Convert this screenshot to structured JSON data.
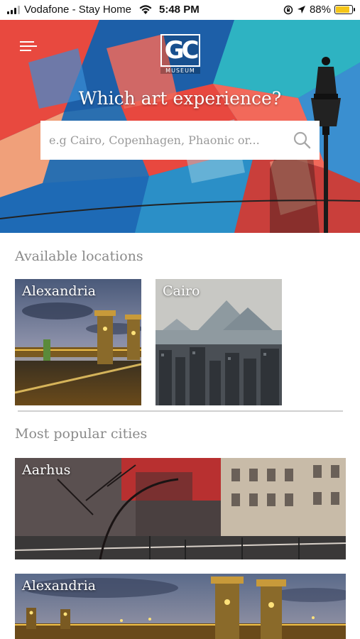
{
  "status_bar": {
    "carrier": "Vodafone - Stay Home",
    "time": "5:48 PM",
    "battery_percent": "88%",
    "battery_level": 0.88,
    "battery_color": "#f5c518",
    "icons": [
      "signal-icon",
      "wifi-icon",
      "orientation-lock-icon",
      "location-arrow-icon",
      "battery-icon"
    ]
  },
  "header": {
    "logo_letters": "GC",
    "logo_subtitle": "MUSEUM",
    "title": "Which art experience?",
    "menu_icon": "hamburger-menu-icon"
  },
  "search": {
    "placeholder": "e.g Cairo, Copenhagen, Phaonic or...",
    "value": "",
    "icon": "search-icon"
  },
  "available_locations": {
    "title": "Available locations",
    "items": [
      {
        "label": "Alexandria"
      },
      {
        "label": "Cairo"
      }
    ]
  },
  "popular_cities": {
    "title": "Most popular cities",
    "items": [
      {
        "label": "Aarhus"
      },
      {
        "label": "Alexandria"
      }
    ]
  },
  "colors": {
    "hero_red": "#e8483f",
    "hero_blue": "#1f6fb2",
    "hero_teal": "#2eb3c2",
    "section_title": "#8a8a8a"
  }
}
